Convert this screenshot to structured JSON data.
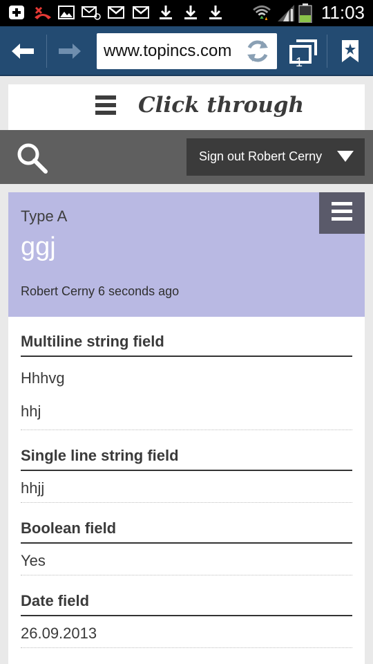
{
  "status_bar": {
    "time": "11:03",
    "icons": [
      "add-icon",
      "missed-call-icon",
      "image-icon",
      "email-icon",
      "gmail-icon",
      "gmail-icon",
      "download-icon",
      "download-icon",
      "download-icon",
      "wifi-icon",
      "signal-icon",
      "battery-icon"
    ]
  },
  "browser": {
    "url": "www.topincs.com",
    "tab_count": "1",
    "toolbar_color": "#234b72"
  },
  "site": {
    "title": "Click through"
  },
  "nav": {
    "signout_label": "Sign out Robert Cerny"
  },
  "topic": {
    "type": "Type A",
    "name": "ggj",
    "byline": "Robert Cerny 6 seconds ago",
    "header_color": "#b9b9e3"
  },
  "fields": [
    {
      "title": "Multiline string field",
      "values": [
        "Hhhvg",
        "hhj"
      ]
    },
    {
      "title": "Single line string field",
      "values": [
        "hhjj"
      ]
    },
    {
      "title": "Boolean field",
      "values": [
        "Yes"
      ]
    },
    {
      "title": "Date field",
      "values": [
        "26.09.2013"
      ]
    }
  ]
}
